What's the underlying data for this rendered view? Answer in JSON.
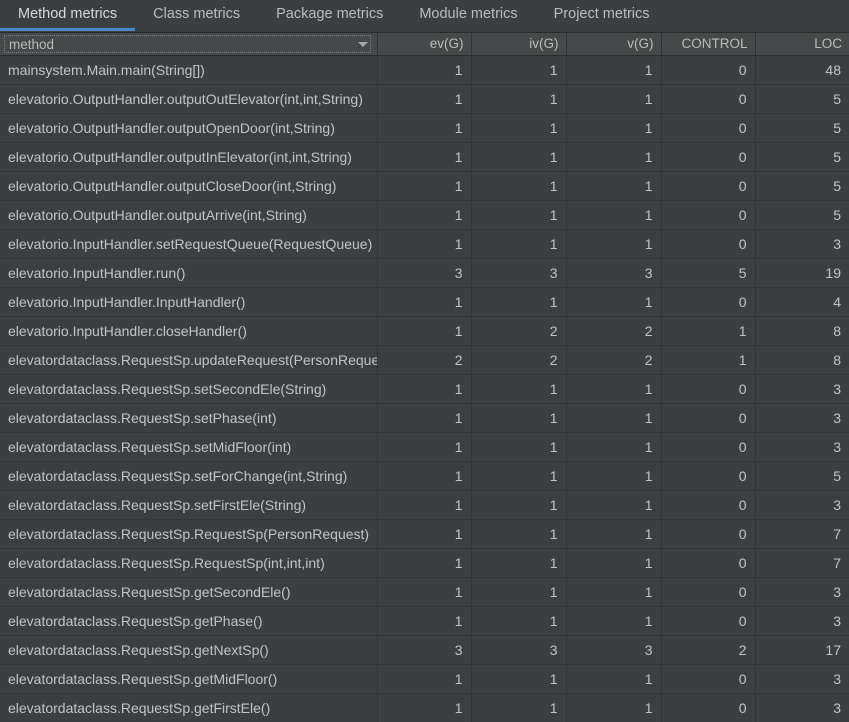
{
  "tabs": [
    {
      "label": "Method metrics",
      "active": true
    },
    {
      "label": "Class metrics",
      "active": false
    },
    {
      "label": "Package metrics",
      "active": false
    },
    {
      "label": "Module metrics",
      "active": false
    },
    {
      "label": "Project metrics",
      "active": false
    }
  ],
  "table": {
    "columns": [
      {
        "key": "method",
        "label": "method",
        "align": "left"
      },
      {
        "key": "ev",
        "label": "ev(G)",
        "align": "right"
      },
      {
        "key": "iv",
        "label": "iv(G)",
        "align": "right"
      },
      {
        "key": "v",
        "label": "v(G)",
        "align": "right"
      },
      {
        "key": "control",
        "label": "CONTROL",
        "align": "right"
      },
      {
        "key": "loc",
        "label": "LOC",
        "align": "right"
      }
    ],
    "sort_column": "method",
    "sort_icon": "chevron-down-icon",
    "rows": [
      {
        "method": "mainsystem.Main.main(String[])",
        "ev": "1",
        "iv": "1",
        "v": "1",
        "control": "0",
        "loc": "48"
      },
      {
        "method": "elevatorio.OutputHandler.outputOutElevator(int,int,String)",
        "ev": "1",
        "iv": "1",
        "v": "1",
        "control": "0",
        "loc": "5"
      },
      {
        "method": "elevatorio.OutputHandler.outputOpenDoor(int,String)",
        "ev": "1",
        "iv": "1",
        "v": "1",
        "control": "0",
        "loc": "5"
      },
      {
        "method": "elevatorio.OutputHandler.outputInElevator(int,int,String)",
        "ev": "1",
        "iv": "1",
        "v": "1",
        "control": "0",
        "loc": "5"
      },
      {
        "method": "elevatorio.OutputHandler.outputCloseDoor(int,String)",
        "ev": "1",
        "iv": "1",
        "v": "1",
        "control": "0",
        "loc": "5"
      },
      {
        "method": "elevatorio.OutputHandler.outputArrive(int,String)",
        "ev": "1",
        "iv": "1",
        "v": "1",
        "control": "0",
        "loc": "5"
      },
      {
        "method": "elevatorio.InputHandler.setRequestQueue(RequestQueue)",
        "ev": "1",
        "iv": "1",
        "v": "1",
        "control": "0",
        "loc": "3"
      },
      {
        "method": "elevatorio.InputHandler.run()",
        "ev": "3",
        "iv": "3",
        "v": "3",
        "control": "5",
        "loc": "19"
      },
      {
        "method": "elevatorio.InputHandler.InputHandler()",
        "ev": "1",
        "iv": "1",
        "v": "1",
        "control": "0",
        "loc": "4"
      },
      {
        "method": "elevatorio.InputHandler.closeHandler()",
        "ev": "1",
        "iv": "2",
        "v": "2",
        "control": "1",
        "loc": "8"
      },
      {
        "method": "elevatordataclass.RequestSp.updateRequest(PersonRequest)",
        "ev": "2",
        "iv": "2",
        "v": "2",
        "control": "1",
        "loc": "8"
      },
      {
        "method": "elevatordataclass.RequestSp.setSecondEle(String)",
        "ev": "1",
        "iv": "1",
        "v": "1",
        "control": "0",
        "loc": "3"
      },
      {
        "method": "elevatordataclass.RequestSp.setPhase(int)",
        "ev": "1",
        "iv": "1",
        "v": "1",
        "control": "0",
        "loc": "3"
      },
      {
        "method": "elevatordataclass.RequestSp.setMidFloor(int)",
        "ev": "1",
        "iv": "1",
        "v": "1",
        "control": "0",
        "loc": "3"
      },
      {
        "method": "elevatordataclass.RequestSp.setForChange(int,String)",
        "ev": "1",
        "iv": "1",
        "v": "1",
        "control": "0",
        "loc": "5"
      },
      {
        "method": "elevatordataclass.RequestSp.setFirstEle(String)",
        "ev": "1",
        "iv": "1",
        "v": "1",
        "control": "0",
        "loc": "3"
      },
      {
        "method": "elevatordataclass.RequestSp.RequestSp(PersonRequest)",
        "ev": "1",
        "iv": "1",
        "v": "1",
        "control": "0",
        "loc": "7"
      },
      {
        "method": "elevatordataclass.RequestSp.RequestSp(int,int,int)",
        "ev": "1",
        "iv": "1",
        "v": "1",
        "control": "0",
        "loc": "7"
      },
      {
        "method": "elevatordataclass.RequestSp.getSecondEle()",
        "ev": "1",
        "iv": "1",
        "v": "1",
        "control": "0",
        "loc": "3"
      },
      {
        "method": "elevatordataclass.RequestSp.getPhase()",
        "ev": "1",
        "iv": "1",
        "v": "1",
        "control": "0",
        "loc": "3"
      },
      {
        "method": "elevatordataclass.RequestSp.getNextSp()",
        "ev": "3",
        "iv": "3",
        "v": "3",
        "control": "2",
        "loc": "17"
      },
      {
        "method": "elevatordataclass.RequestSp.getMidFloor()",
        "ev": "1",
        "iv": "1",
        "v": "1",
        "control": "0",
        "loc": "3"
      },
      {
        "method": "elevatordataclass.RequestSp.getFirstEle()",
        "ev": "1",
        "iv": "1",
        "v": "1",
        "control": "0",
        "loc": "3"
      }
    ]
  },
  "colors": {
    "background": "#3c3f41",
    "header_background": "#45494a",
    "accent": "#4a88c7",
    "text": "#bbbbbb",
    "grid": "#323537"
  }
}
